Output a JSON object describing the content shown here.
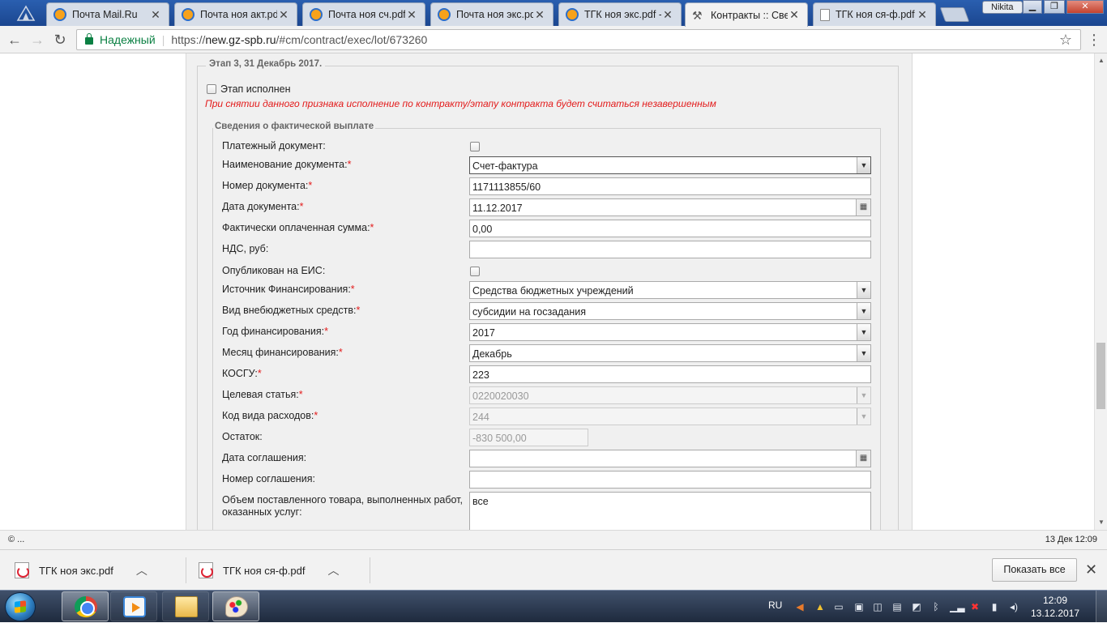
{
  "browser": {
    "tabs": [
      {
        "title": "Почта Mail.Ru",
        "icon": "mailru-icon",
        "active": false
      },
      {
        "title": "Почта ноя акт.pdf",
        "icon": "mailru-icon",
        "active": false
      },
      {
        "title": "Почта ноя сч.pdf",
        "icon": "mailru-icon",
        "active": false
      },
      {
        "title": "Почта ноя экс.pdf",
        "icon": "mailru-icon",
        "active": false
      },
      {
        "title": "ТГК ноя экс.pdf -",
        "icon": "mailru-icon",
        "active": false
      },
      {
        "title": "Контракты :: Свед",
        "icon": "tools-icon",
        "active": true
      },
      {
        "title": "ТГК ноя ся-ф.pdf",
        "icon": "pdf-icon",
        "active": false
      }
    ],
    "user": "Nikita",
    "secure_label": "Надежный",
    "url_scheme": "https://",
    "url_host": "new.gz-spb.ru",
    "url_path": "/#cm/contract/exec/lot/673260"
  },
  "page": {
    "stage_legend": "Этап 3, 31 Декабрь 2017.",
    "stage_done_label": "Этап исполнен",
    "warning": "При снятии данного признака исполнение по контракту/этапу контракта будет считаться незавершенным",
    "payment_legend": "Сведения о фактической выплате",
    "fields": {
      "payment_doc": "Платежный документ:",
      "doc_name_label": "Наименование документа:",
      "doc_name_value": "Счет-фактура",
      "doc_number_label": "Номер документа:",
      "doc_number_value": "1171113855/60",
      "doc_date_label": "Дата документа:",
      "doc_date_value": "11.12.2017",
      "paid_sum_label": "Фактически оплаченная сумма:",
      "paid_sum_value": "0,00",
      "vat_label": "НДС, руб:",
      "vat_value": "",
      "published_label": "Опубликован на ЕИС:",
      "funding_source_label": "Источник Финансирования:",
      "funding_source_value": "Средства бюджетных учреждений",
      "offbudget_label": "Вид внебюджетных средств:",
      "offbudget_value": "субсидии на госзадания",
      "funding_year_label": "Год финансирования:",
      "funding_year_value": "2017",
      "funding_month_label": "Месяц финансирования:",
      "funding_month_value": "Декабрь",
      "kosgu_label": "КОСГУ:",
      "kosgu_value": "223",
      "target_item_label": "Целевая статья:",
      "target_item_value": "0220020030",
      "expense_code_label": "Код вида расходов:",
      "expense_code_value": "244",
      "balance_label": "Остаток:",
      "balance_value": "-830 500,00",
      "agreement_date_label": "Дата соглашения:",
      "agreement_date_value": "",
      "agreement_number_label": "Номер соглашения:",
      "agreement_number_value": "",
      "volume_label": "Объем поставленного товара, выполненных работ, оказанных услуг:",
      "volume_value": "все"
    },
    "required_mark": "*"
  },
  "statusbar": {
    "left": "© ...",
    "right": "13 Дек 12:09"
  },
  "downloads": {
    "items": [
      "ТГК ноя экс.pdf",
      "ТГК ноя ся-ф.pdf"
    ],
    "show_all": "Показать все"
  },
  "taskbar": {
    "lang": "RU",
    "time": "12:09",
    "date": "13.12.2017"
  },
  "colors": {
    "required": "#e31b1b",
    "secure": "#0b8043",
    "tabstrip": "#1f4e9a"
  }
}
